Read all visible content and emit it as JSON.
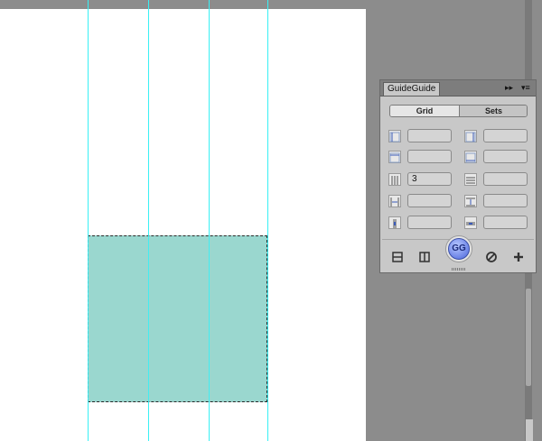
{
  "panel": {
    "title": "GuideGuide",
    "header_controls": {
      "collapse": "▸▸",
      "menu": "▾≡"
    },
    "tabs": [
      {
        "label": "Grid",
        "active": true
      },
      {
        "label": "Sets",
        "active": false
      }
    ],
    "fields": [
      {
        "name": "left-margin",
        "value": ""
      },
      {
        "name": "right-margin",
        "value": ""
      },
      {
        "name": "top-margin",
        "value": ""
      },
      {
        "name": "bottom-margin",
        "value": ""
      },
      {
        "name": "columns",
        "value": "3"
      },
      {
        "name": "rows",
        "value": ""
      },
      {
        "name": "column-width",
        "value": ""
      },
      {
        "name": "row-height",
        "value": ""
      },
      {
        "name": "column-gutter",
        "value": ""
      },
      {
        "name": "row-gutter",
        "value": ""
      }
    ],
    "gg_button_label": "GG",
    "footer_icons": [
      "horizontal-midpoint-icon",
      "vertical-midpoint-icon",
      "clear-guides-icon",
      "add-set-icon"
    ]
  },
  "colors": {
    "selection_fill": "#9ad7cf",
    "guide": "#38f0f5",
    "gg_button": "#6a82e6"
  }
}
